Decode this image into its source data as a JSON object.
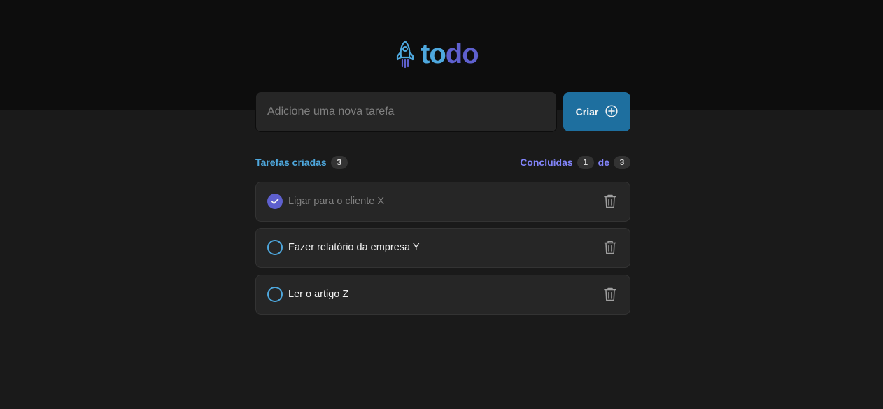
{
  "app": {
    "logo_part1": "to",
    "logo_part2": "do",
    "logo_icon": "rocket-icon",
    "colors": {
      "header_bg": "#0d0d0d",
      "body_bg": "#1a1a1a",
      "blue": "#4ea8de",
      "purple": "#5e60ce",
      "purple_light": "#8284fa",
      "button_bg": "#1e6f9f"
    }
  },
  "new_task": {
    "placeholder": "Adicione uma nova tarefa",
    "value": "",
    "button_label": "Criar",
    "button_icon": "plus-circle-icon"
  },
  "info": {
    "created_label": "Tarefas criadas",
    "created_count": "3",
    "done_label": "Concluídas",
    "done_count": "1",
    "of_label": "de",
    "total_count": "3"
  },
  "tasks": [
    {
      "text": "Ligar para o cliente X",
      "done": true
    },
    {
      "text": "Fazer relatório da empresa Y",
      "done": false
    },
    {
      "text": "Ler o artigo Z",
      "done": false
    }
  ]
}
